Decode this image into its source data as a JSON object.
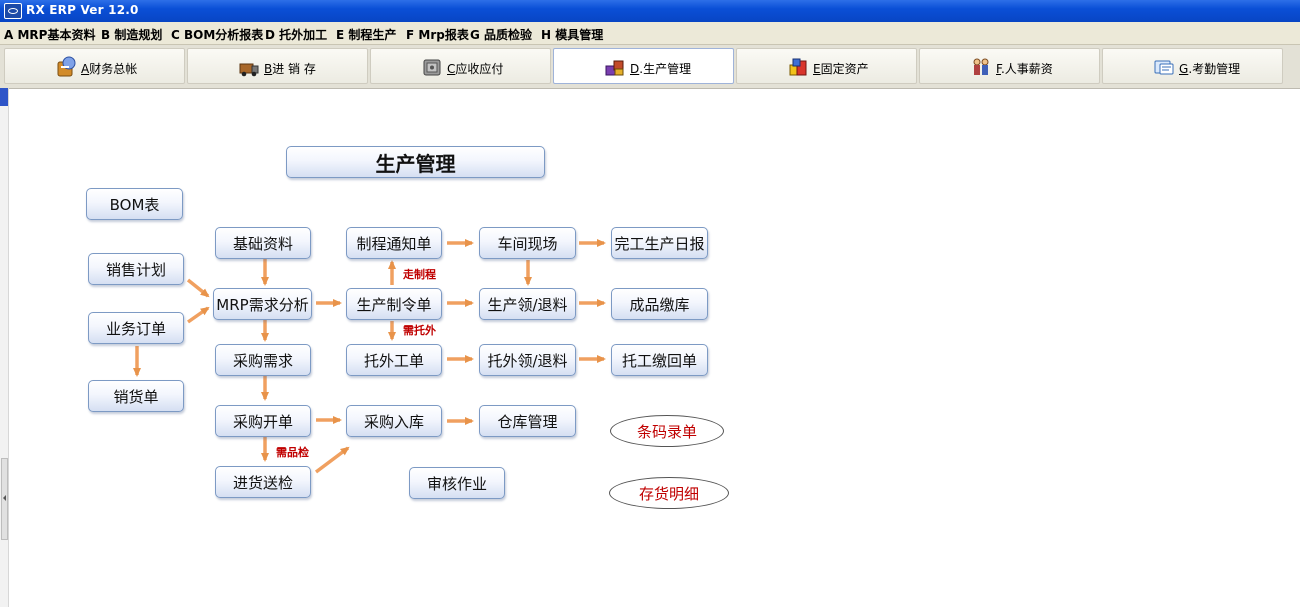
{
  "window": {
    "title": "RX ERP Ver 12.0"
  },
  "menu": [
    "A MRP基本资料",
    "B 制造规划",
    "C BOM分析报表",
    "D 托外加工",
    "E 制程生产",
    "F Mrp报表",
    "G 品质检验",
    "H 模具管理"
  ],
  "tabs": [
    {
      "key": "A",
      "label": "财务总帐",
      "icon": "ledger-icon"
    },
    {
      "key": "B",
      "label": "进  销  存",
      "icon": "truck-icon"
    },
    {
      "key": "C",
      "label": "应收应付",
      "icon": "safe-icon"
    },
    {
      "key": "D",
      "label": ".生产管理",
      "icon": "production-icon",
      "active": true
    },
    {
      "key": "E",
      "label": "固定资产",
      "icon": "building-blocks-icon"
    },
    {
      "key": "F",
      "label": ".人事薪资",
      "icon": "people-icon"
    },
    {
      "key": "G",
      "label": ".考勤管理",
      "icon": "attendance-card-icon"
    }
  ],
  "flow": {
    "title": "生产管理",
    "bom": "BOM表",
    "sales_plan": "销售计划",
    "sales_order": "业务订单",
    "delivery_note": "销货单",
    "base_data": "基础资料",
    "mrp_analysis": "MRP需求分析",
    "purchase_request": "采购需求",
    "purchase_order": "采购开单",
    "incoming_inspection": "进货送检",
    "process_notice": "制程通知单",
    "production_order": "生产制令单",
    "outsource_order": "托外工单",
    "purchase_receipt": "采购入库",
    "audit": "审核作业",
    "workshop": "车间现场",
    "production_issue": "生产领/退料",
    "outsource_issue": "托外领/退料",
    "warehouse": "仓库管理",
    "daily_report": "完工生产日报",
    "finished_goods": "成品缴库",
    "outsource_return": "托工缴回单",
    "barcode_entry": "条码录单",
    "inventory_detail": "存货明细",
    "note_process": "走制程",
    "note_outsource": "需托外",
    "note_inspection": "需品检"
  }
}
